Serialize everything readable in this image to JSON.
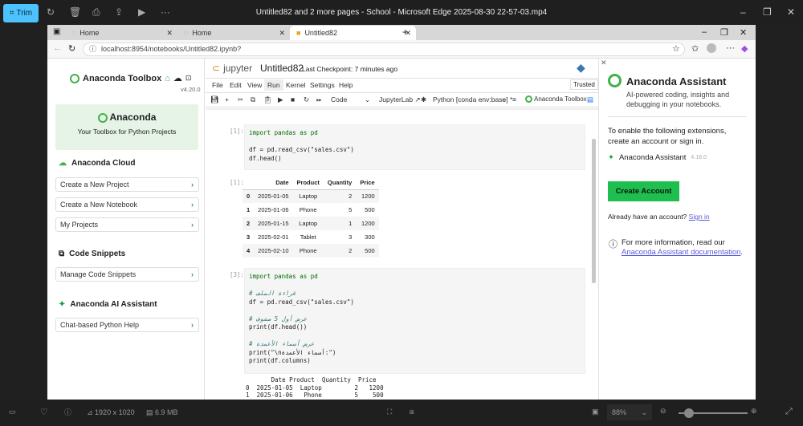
{
  "player": {
    "trim_label": "Trim",
    "window_title": "Untitled82 and 2 more pages - School - Microsoft Edge 2025-08-30 22-57-03.mp4",
    "resolution": "1920 x 1020",
    "file_size": "6.9 MB",
    "zoom": "88%"
  },
  "browser": {
    "tabs": [
      {
        "label": "Home"
      },
      {
        "label": "Home"
      },
      {
        "label": "Untitled82"
      }
    ],
    "url": "localhost:8954/notebooks/Untitled82.ipynb?"
  },
  "toolbox": {
    "title": "Anaconda Toolbox",
    "version": "v4.20.0",
    "card_title": "Anaconda",
    "card_subtitle": "Your Toolbox for Python Projects",
    "sections": [
      {
        "title": "Anaconda Cloud",
        "items": [
          "Create a New Project",
          "Create a New Notebook",
          "My Projects"
        ]
      },
      {
        "title": "Code Snippets",
        "items": [
          "Manage Code Snippets"
        ]
      },
      {
        "title": "Anaconda AI Assistant",
        "items": [
          "Chat-based Python Help"
        ]
      }
    ]
  },
  "notebook": {
    "logo": "jupyter",
    "name": "Untitled82",
    "checkpoint": "Last Checkpoint: 7 minutes ago",
    "menu": [
      "File",
      "Edit",
      "View",
      "Run",
      "Kernel",
      "Settings",
      "Help"
    ],
    "trusted": "Trusted",
    "cell_type": "Code",
    "jupyterlab": "JupyterLab",
    "kernel": "Python [conda env:base] *",
    "toolbox_btn": "Anaconda Toolbox",
    "cell1": {
      "prompt": "[1]:",
      "out_prompt": "[1]:",
      "lines": [
        "import pandas as pd",
        "",
        "df = pd.read_csv(\"sales.csv\")",
        "df.head()"
      ]
    },
    "table": {
      "headers": [
        "",
        "Date",
        "Product",
        "Quantity",
        "Price"
      ],
      "rows": [
        [
          "0",
          "2025-01-05",
          "Laptop",
          "2",
          "1200"
        ],
        [
          "1",
          "2025-01-06",
          "Phone",
          "5",
          "500"
        ],
        [
          "2",
          "2025-01-15",
          "Laptop",
          "1",
          "1200"
        ],
        [
          "3",
          "2025-02-01",
          "Tablet",
          "3",
          "300"
        ],
        [
          "4",
          "2025-02-10",
          "Phone",
          "2",
          "500"
        ]
      ]
    },
    "cell3": {
      "prompt": "[3]:",
      "lines": [
        "import pandas as pd",
        "",
        "# قراءة الملف",
        "df = pd.read_csv(\"sales.csv\")",
        "",
        "# عرض أول 5 صفوف",
        "print(df.head())",
        "",
        "# عرض أسماء الأعمدة",
        "print(\"\\nأسماء الأعمدة:\")",
        "print(df.columns)"
      ],
      "output": [
        "       Date Product  Quantity  Price",
        "0  2025-01-05  Laptop         2   1200",
        "1  2025-01-06   Phone         5    500"
      ]
    }
  },
  "assistant": {
    "title": "Anaconda Assistant",
    "subtitle": "AI-powered coding, insights and debugging in your notebooks.",
    "enable_text": "To enable the following extensions, create an account or sign in.",
    "ext_name": "Anaconda Assistant",
    "ext_version": "4.18.0",
    "create_btn": "Create Account",
    "have_account": "Already have an account?",
    "sign_in": "Sign in",
    "info_text": "For more information, read our",
    "doc_link": "Anaconda Assistant documentation",
    "doc_suffix": "."
  }
}
